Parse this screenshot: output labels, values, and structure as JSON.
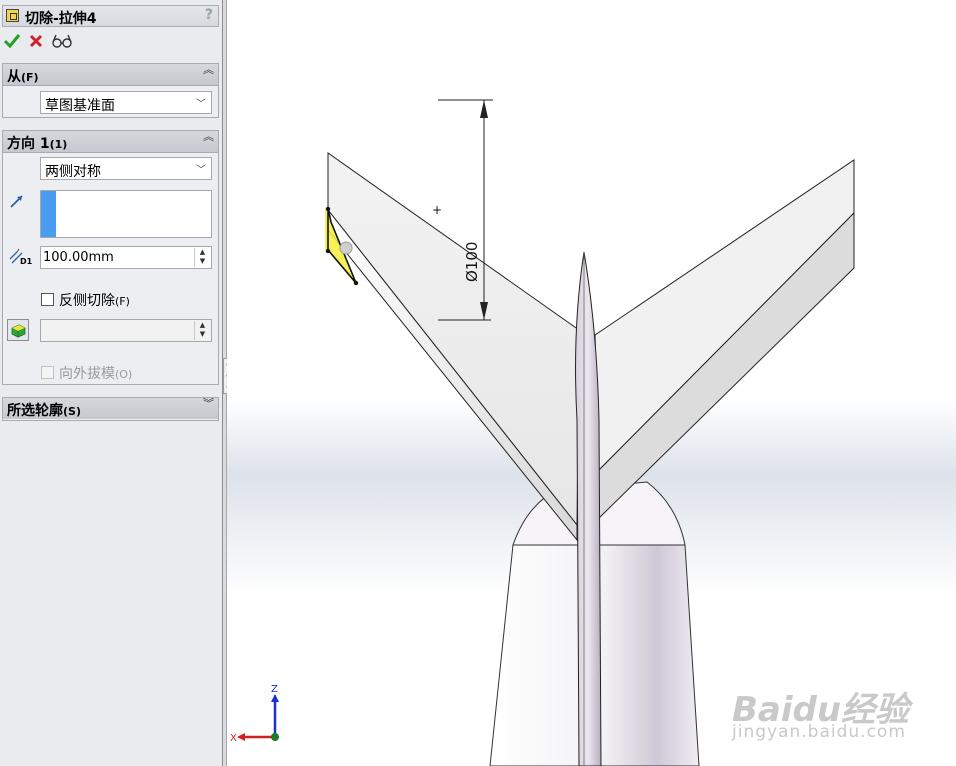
{
  "feature_title": "切除-拉伸4",
  "help_label": "?",
  "actions": {
    "ok_icon": "checkmark-icon",
    "cancel_icon": "x-icon",
    "preview_icon": "glasses-icon"
  },
  "from_group": {
    "title": "从",
    "shortcut": "(F)",
    "selected": "草图基准面"
  },
  "direction1_group": {
    "title": "方向 1",
    "shortcut": "(1)",
    "end_condition": "两侧对称",
    "depth_value": "100.00mm",
    "depth_icon_label": "D1",
    "flip_side_label": "反侧切除",
    "flip_side_shortcut": "(F)",
    "flip_side_checked": false,
    "draft_label": "向外拔模",
    "draft_shortcut": "(O)",
    "draft_enabled": false
  },
  "contours_group": {
    "title": "所选轮廓",
    "shortcut": "(S)"
  },
  "dimension_label": "Ø100",
  "triad": {
    "z_label": "Z",
    "x_label": "X"
  },
  "watermark": {
    "brand": "Baidu经验",
    "url": "jingyan.baidu.com"
  },
  "colors": {
    "accent_blue": "#4a9cf0",
    "sketch_highlight": "#f5ee3a",
    "ok_green": "#22a02a",
    "cancel_red": "#d0202a"
  }
}
